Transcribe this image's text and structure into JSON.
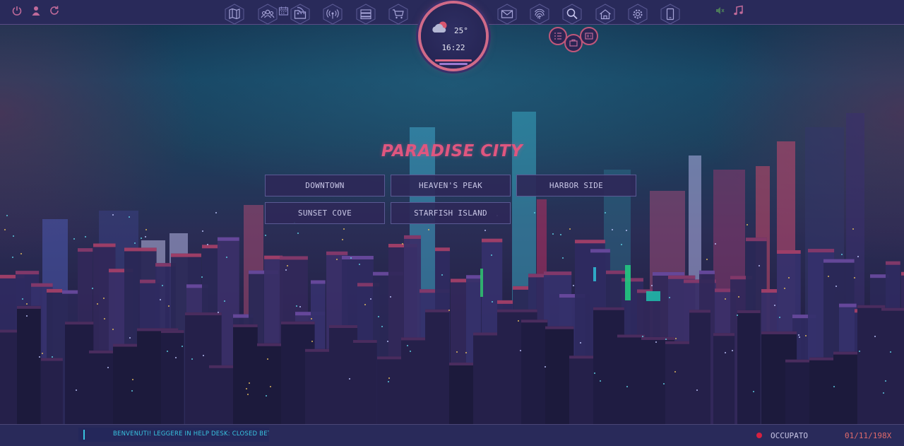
{
  "app": {
    "title": "PARADISE CITY"
  },
  "top_nav": {
    "left_icons": [
      "map-icon",
      "people-icon",
      "folder-icon",
      "broadcast-icon",
      "server-icon",
      "cart-icon"
    ],
    "right_icons": [
      "mail-icon",
      "fingerprint-icon",
      "search-icon",
      "house-icon",
      "gear-icon",
      "phone-icon"
    ]
  },
  "clock": {
    "temperature": "25°",
    "time": "16:22",
    "weather_icon": "cloud-sun-icon"
  },
  "districts": [
    {
      "label": "DOWNTOWN"
    },
    {
      "label": "HEAVEN'S PEAK"
    },
    {
      "label": "HARBOR SIDE"
    },
    {
      "label": "SUNSET COVE"
    },
    {
      "label": "STARFISH ISLAND"
    }
  ],
  "bottom_bar": {
    "marquee_text": "BENVENUTI! LEGGERE IN HELP DESK: CLOSED BETA -",
    "status": "OCCUPATO",
    "date": "01/11/198X"
  },
  "colors": {
    "accent_pink": "#e0567f",
    "bar_bg": "#292a5a",
    "icon_stroke": "#8a88c4",
    "marquee_text": "#38c4e0",
    "date_text": "#e06a6a"
  }
}
